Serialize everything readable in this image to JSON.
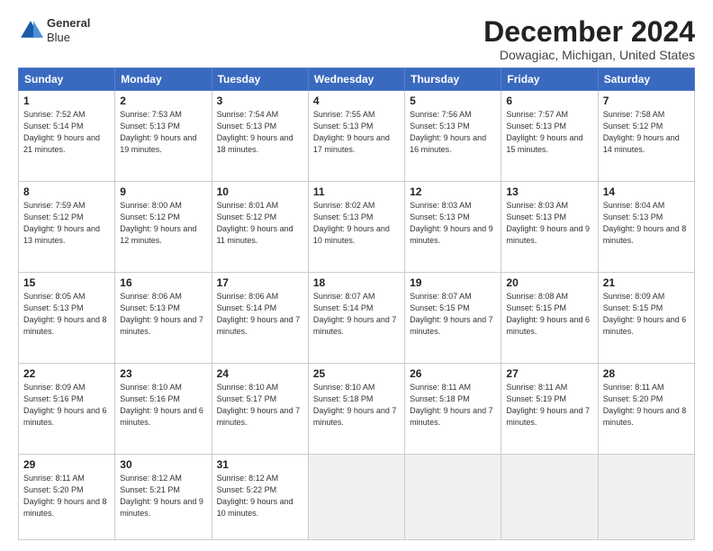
{
  "logo": {
    "line1": "General",
    "line2": "Blue"
  },
  "header": {
    "month_year": "December 2024",
    "location": "Dowagiac, Michigan, United States"
  },
  "days_of_week": [
    "Sunday",
    "Monday",
    "Tuesday",
    "Wednesday",
    "Thursday",
    "Friday",
    "Saturday"
  ],
  "weeks": [
    [
      {
        "day": 1,
        "sunrise": "7:52 AM",
        "sunset": "5:14 PM",
        "daylight": "9 hours and 21 minutes."
      },
      {
        "day": 2,
        "sunrise": "7:53 AM",
        "sunset": "5:13 PM",
        "daylight": "9 hours and 19 minutes."
      },
      {
        "day": 3,
        "sunrise": "7:54 AM",
        "sunset": "5:13 PM",
        "daylight": "9 hours and 18 minutes."
      },
      {
        "day": 4,
        "sunrise": "7:55 AM",
        "sunset": "5:13 PM",
        "daylight": "9 hours and 17 minutes."
      },
      {
        "day": 5,
        "sunrise": "7:56 AM",
        "sunset": "5:13 PM",
        "daylight": "9 hours and 16 minutes."
      },
      {
        "day": 6,
        "sunrise": "7:57 AM",
        "sunset": "5:13 PM",
        "daylight": "9 hours and 15 minutes."
      },
      {
        "day": 7,
        "sunrise": "7:58 AM",
        "sunset": "5:12 PM",
        "daylight": "9 hours and 14 minutes."
      }
    ],
    [
      {
        "day": 8,
        "sunrise": "7:59 AM",
        "sunset": "5:12 PM",
        "daylight": "9 hours and 13 minutes."
      },
      {
        "day": 9,
        "sunrise": "8:00 AM",
        "sunset": "5:12 PM",
        "daylight": "9 hours and 12 minutes."
      },
      {
        "day": 10,
        "sunrise": "8:01 AM",
        "sunset": "5:12 PM",
        "daylight": "9 hours and 11 minutes."
      },
      {
        "day": 11,
        "sunrise": "8:02 AM",
        "sunset": "5:13 PM",
        "daylight": "9 hours and 10 minutes."
      },
      {
        "day": 12,
        "sunrise": "8:03 AM",
        "sunset": "5:13 PM",
        "daylight": "9 hours and 9 minutes."
      },
      {
        "day": 13,
        "sunrise": "8:03 AM",
        "sunset": "5:13 PM",
        "daylight": "9 hours and 9 minutes."
      },
      {
        "day": 14,
        "sunrise": "8:04 AM",
        "sunset": "5:13 PM",
        "daylight": "9 hours and 8 minutes."
      }
    ],
    [
      {
        "day": 15,
        "sunrise": "8:05 AM",
        "sunset": "5:13 PM",
        "daylight": "9 hours and 8 minutes."
      },
      {
        "day": 16,
        "sunrise": "8:06 AM",
        "sunset": "5:13 PM",
        "daylight": "9 hours and 7 minutes."
      },
      {
        "day": 17,
        "sunrise": "8:06 AM",
        "sunset": "5:14 PM",
        "daylight": "9 hours and 7 minutes."
      },
      {
        "day": 18,
        "sunrise": "8:07 AM",
        "sunset": "5:14 PM",
        "daylight": "9 hours and 7 minutes."
      },
      {
        "day": 19,
        "sunrise": "8:07 AM",
        "sunset": "5:15 PM",
        "daylight": "9 hours and 7 minutes."
      },
      {
        "day": 20,
        "sunrise": "8:08 AM",
        "sunset": "5:15 PM",
        "daylight": "9 hours and 6 minutes."
      },
      {
        "day": 21,
        "sunrise": "8:09 AM",
        "sunset": "5:15 PM",
        "daylight": "9 hours and 6 minutes."
      }
    ],
    [
      {
        "day": 22,
        "sunrise": "8:09 AM",
        "sunset": "5:16 PM",
        "daylight": "9 hours and 6 minutes."
      },
      {
        "day": 23,
        "sunrise": "8:10 AM",
        "sunset": "5:16 PM",
        "daylight": "9 hours and 6 minutes."
      },
      {
        "day": 24,
        "sunrise": "8:10 AM",
        "sunset": "5:17 PM",
        "daylight": "9 hours and 7 minutes."
      },
      {
        "day": 25,
        "sunrise": "8:10 AM",
        "sunset": "5:18 PM",
        "daylight": "9 hours and 7 minutes."
      },
      {
        "day": 26,
        "sunrise": "8:11 AM",
        "sunset": "5:18 PM",
        "daylight": "9 hours and 7 minutes."
      },
      {
        "day": 27,
        "sunrise": "8:11 AM",
        "sunset": "5:19 PM",
        "daylight": "9 hours and 7 minutes."
      },
      {
        "day": 28,
        "sunrise": "8:11 AM",
        "sunset": "5:20 PM",
        "daylight": "9 hours and 8 minutes."
      }
    ],
    [
      {
        "day": 29,
        "sunrise": "8:11 AM",
        "sunset": "5:20 PM",
        "daylight": "9 hours and 8 minutes."
      },
      {
        "day": 30,
        "sunrise": "8:12 AM",
        "sunset": "5:21 PM",
        "daylight": "9 hours and 9 minutes."
      },
      {
        "day": 31,
        "sunrise": "8:12 AM",
        "sunset": "5:22 PM",
        "daylight": "9 hours and 10 minutes."
      },
      null,
      null,
      null,
      null
    ]
  ]
}
